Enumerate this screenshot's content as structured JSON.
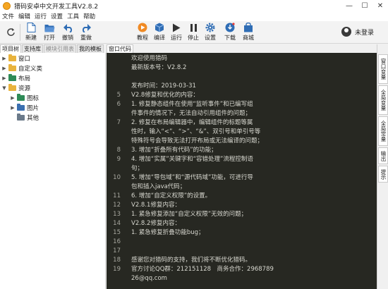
{
  "window": {
    "title": "猎码安卓中文开发工具V2.8.2",
    "controls": [
      "—",
      "☐",
      "✕"
    ]
  },
  "menu": [
    "文件",
    "编辑",
    "运行",
    "设置",
    "工具",
    "帮助"
  ],
  "toolbar": {
    "buttons": [
      {
        "label": "新建",
        "icon": "new-file-icon"
      },
      {
        "label": "打开",
        "icon": "open-folder-icon"
      },
      {
        "label": "撤销",
        "icon": "undo-icon"
      },
      {
        "label": "重做",
        "icon": "redo-icon"
      },
      {
        "label": "教程",
        "icon": "tutorial-icon"
      },
      {
        "label": "编译",
        "icon": "compile-icon"
      },
      {
        "label": "运行",
        "icon": "run-icon"
      },
      {
        "label": "停止",
        "icon": "stop-icon"
      },
      {
        "label": "设置",
        "icon": "gear-icon"
      },
      {
        "label": "下载",
        "icon": "download-icon"
      },
      {
        "label": "商城",
        "icon": "store-icon"
      }
    ],
    "login_label": "未登录"
  },
  "left_panel": {
    "tabs": [
      {
        "label": "项目树",
        "active": true,
        "disabled": false
      },
      {
        "label": "支持库",
        "active": false,
        "disabled": false
      },
      {
        "label": "模块引用表",
        "active": false,
        "disabled": true
      },
      {
        "label": "我的模板",
        "active": false,
        "disabled": false
      }
    ],
    "tree": [
      {
        "label": "窗口",
        "level": 0,
        "expanded": false,
        "color": "#e8b33d"
      },
      {
        "label": "自定义类",
        "level": 0,
        "expanded": false,
        "color": "#e8b33d"
      },
      {
        "label": "布局",
        "level": 0,
        "expanded": false,
        "color": "#2e8b57"
      },
      {
        "label": "资源",
        "level": 0,
        "expanded": true,
        "color": "#e8b33d"
      },
      {
        "label": "图标",
        "level": 1,
        "expanded": false,
        "color": "#2e8b57"
      },
      {
        "label": "图片",
        "level": 1,
        "expanded": false,
        "color": "#3a6fb0"
      },
      {
        "label": "其他",
        "level": 1,
        "expanded": null,
        "color": "#6b7a8a"
      }
    ]
  },
  "editor": {
    "tab_label": "窗口代码",
    "lines": [
      {
        "num": "",
        "text": "欢迎使用猎码"
      },
      {
        "num": "",
        "text": "最新版本号：V2.8.2"
      },
      {
        "num": "",
        "text": ""
      },
      {
        "num": "",
        "text": "发布时间：2019-03-31"
      },
      {
        "num": "5",
        "text": "V2.8修复和优化的内容："
      },
      {
        "num": "6",
        "text": "1. 修复静态组件在使用“监听事件”和已编写组"
      },
      {
        "num": "",
        "text": "件事件的情况下，无法自动引用组件的问题；"
      },
      {
        "num": "7",
        "text": "2. 修复在布局编辑器中，编辑组件的标题等属"
      },
      {
        "num": "",
        "text": "性时，输入“<”、“>”、“&”、双引号和单引号等"
      },
      {
        "num": "",
        "text": "特殊符号会导致无法打开布局或无法编译的问题；"
      },
      {
        "num": "8",
        "text": "3. 增加“折叠所有代码”的功能；"
      },
      {
        "num": "9",
        "text": "4. 增加“实属”关键字和“容错处理”流程控制语"
      },
      {
        "num": "",
        "text": "句；"
      },
      {
        "num": "10",
        "text": "5. 增加“导包域”和“源代码域”功能，可进行导"
      },
      {
        "num": "",
        "text": "包和插入java代码；"
      },
      {
        "num": "11",
        "text": "6. 增加“自定义权限”的设置。"
      },
      {
        "num": "12",
        "text": "V2.8.1修复内容："
      },
      {
        "num": "13",
        "text": "1. 紧急修复添加“自定义权限”无效的问题；"
      },
      {
        "num": "14",
        "text": "V2.8.2修复内容："
      },
      {
        "num": "15",
        "text": "1. 紧急修复折叠功能bug；"
      },
      {
        "num": "16",
        "text": ""
      },
      {
        "num": "17",
        "text": ""
      },
      {
        "num": "18",
        "text": "感谢您对猎码的支持，我们将不断优化猎码。"
      },
      {
        "num": "19",
        "text": "官方讨论QQ群：212151128　商务合作：2968789"
      },
      {
        "num": "",
        "text": "26@qq.com"
      }
    ]
  },
  "right_panel": {
    "tabs": [
      "窗口变量",
      "全局变量",
      "全局常量",
      "输出",
      "提示"
    ]
  },
  "colors": {
    "editor_bg": "#272822",
    "editor_text": "#d8d8d0",
    "accent_blue": "#2f6db5"
  }
}
